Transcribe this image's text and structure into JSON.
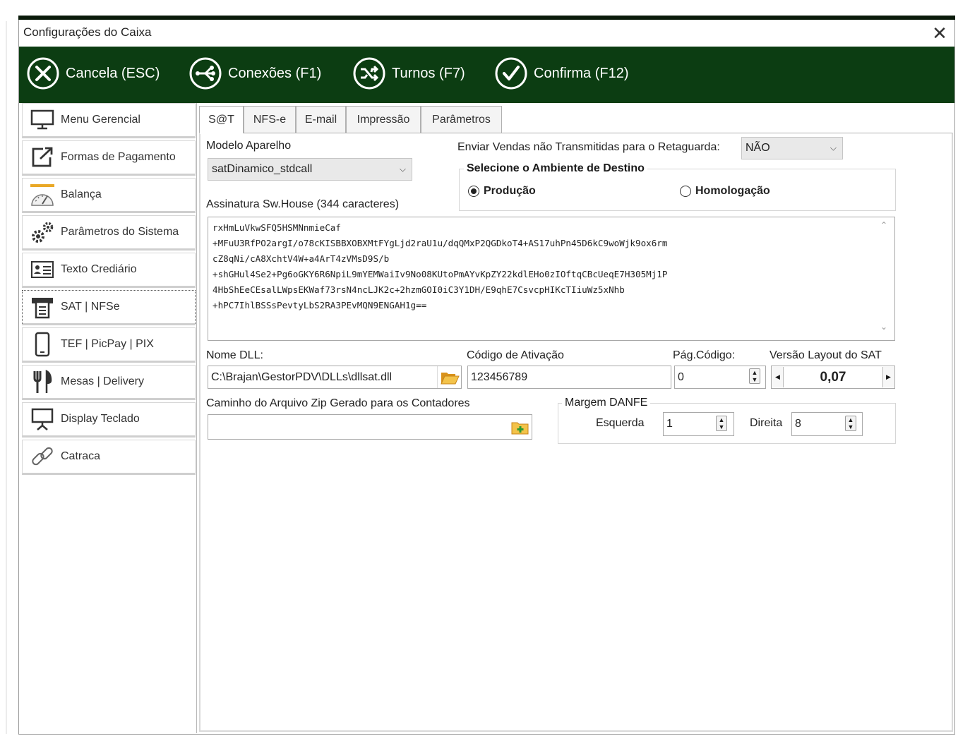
{
  "window": {
    "title": "Configurações do Caixa",
    "close_glyph": "✕"
  },
  "toolbar": {
    "buttons": [
      {
        "label": "Cancela (ESC)",
        "icon": "cancel-icon"
      },
      {
        "label": "Conexões (F1)",
        "icon": "connections-icon"
      },
      {
        "label": "Turnos (F7)",
        "icon": "shuffle-icon"
      },
      {
        "label": "Confirma (F12)",
        "icon": "check-icon"
      }
    ]
  },
  "sidebar": {
    "items": [
      {
        "label": "Menu Gerencial",
        "icon": "monitor-icon"
      },
      {
        "label": "Formas de Pagamento",
        "icon": "edit-external-icon"
      },
      {
        "label": "Balança",
        "icon": "scale-icon"
      },
      {
        "label": "Parâmetros do Sistema",
        "icon": "gears-icon"
      },
      {
        "label": "Texto Crediário",
        "icon": "id-card-icon"
      },
      {
        "label": "SAT | NFSe",
        "icon": "printer-icon"
      },
      {
        "label": "TEF | PicPay | PIX",
        "icon": "phone-icon"
      },
      {
        "label": "Mesas | Delivery",
        "icon": "cutlery-icon"
      },
      {
        "label": "Display Teclado",
        "icon": "display-icon"
      },
      {
        "label": "Catraca",
        "icon": "link-icon"
      }
    ],
    "selected": "SAT | NFSe"
  },
  "tabs": [
    "S@T",
    "NFS-e",
    "E-mail",
    "Impressão",
    "Parâmetros"
  ],
  "active_tab": "S@T",
  "sat": {
    "modelo_label": "Modelo Aparelho",
    "modelo_value": "satDinamico_stdcall",
    "enviar_label": "Enviar Vendas não Transmitidas para o Retaguarda:",
    "enviar_value": "NÃO",
    "ambiente_title": "Selecione o Ambiente de Destino",
    "ambiente_options": [
      "Produção",
      "Homologação"
    ],
    "ambiente_selected": "Produção",
    "assinatura_label": "Assinatura Sw.House (344 caracteres)",
    "assinatura_lines": [
      "rxHmLuVkwSFQ5HSMNnmieCaf",
      "+MFuU3RfPO2argI/o78cKISBBXOBXMtFYgLjd2raU1u/dqQMxP2QGDkoT4+AS17uhPn45D6kC9woWjk9ox6rm",
      "cZ8qNi/cA8XchtV4W+a4ArT4zVMsD9S/b",
      "+shGHul4Se2+Pg6oGKY6R6NpiL9mYEMWaiIv9No08KUtoPmAYvKpZY22kdlEHo0zIOftqCBcUeqE7H305Mj1P",
      "4HbShEeCEsalLWpsEKWaf73rsN4ncLJK2c+2hzmGOI0iC3Y1DH/E9qhE7CsvcpHIKcTIiuWz5xNhb",
      "+hPC7IhlBSSsPevtyLbS2RA3PEvMQN9ENGAH1g=="
    ],
    "nome_dll_label": "Nome DLL:",
    "nome_dll_value": "C:\\Brajan\\GestorPDV\\DLLs\\dllsat.dll",
    "codigo_ativacao_label": "Código de Ativação",
    "codigo_ativacao_value": "123456789",
    "pag_codigo_label": "Pág.Código:",
    "pag_codigo_value": "0",
    "versao_layout_label": "Versão Layout do SAT",
    "versao_layout_value": "0,07",
    "caminho_zip_label": "Caminho do Arquivo Zip Gerado para os Contadores",
    "caminho_zip_value": "",
    "margem_title": "Margem DANFE",
    "esquerda_label": "Esquerda",
    "esquerda_value": "1",
    "direita_label": "Direita",
    "direita_value": "8"
  },
  "colors": {
    "toolbar_bg": "#0c3d12",
    "accent_folder": "#e9a826"
  }
}
